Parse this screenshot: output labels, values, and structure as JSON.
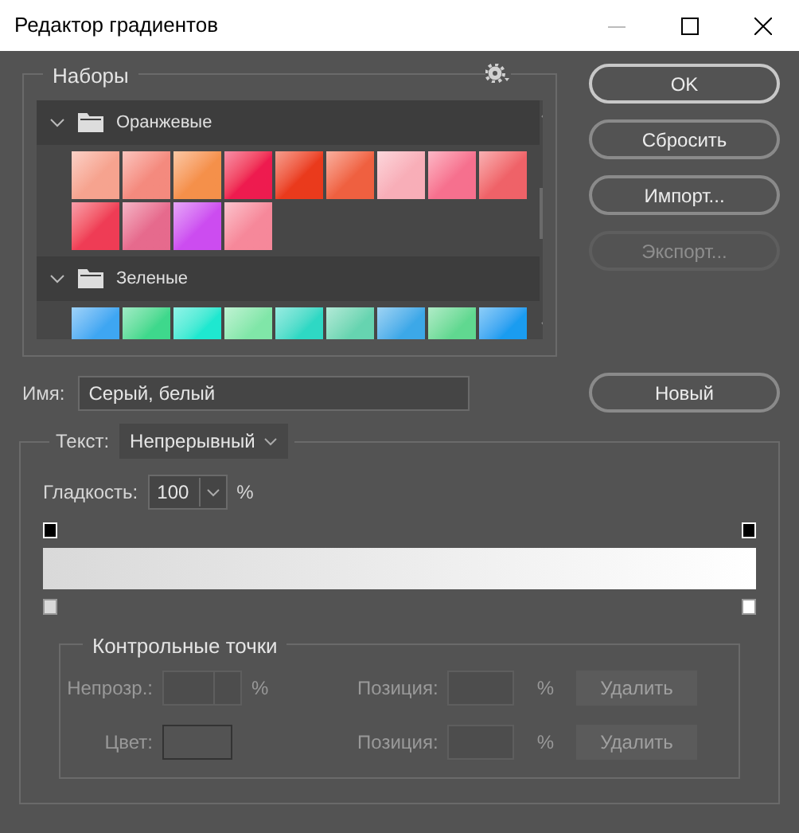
{
  "window": {
    "title": "Редактор градиентов"
  },
  "presets": {
    "title": "Наборы",
    "groups": [
      {
        "name": "Оранжевые",
        "expanded": true,
        "swatches": [
          {
            "color": "#f6a38f"
          },
          {
            "color": "#f48a7e"
          },
          {
            "color": "#f5904a"
          },
          {
            "color": "#ee1b4f"
          },
          {
            "color": "#ea3a1c"
          },
          {
            "color": "#ef6040"
          },
          {
            "color": "#f8aeb8"
          },
          {
            "color": "#f6708e"
          },
          {
            "color": "#ef6268"
          },
          {
            "color": "#ef3c55"
          },
          {
            "color": "#e66a8d"
          },
          {
            "color": "#cc4cf0"
          },
          {
            "color": "#f6889a"
          }
        ]
      },
      {
        "name": "Зеленые",
        "expanded": true,
        "swatches": [
          {
            "color": "#3ea6f2"
          },
          {
            "color": "#3ed88c"
          },
          {
            "color": "#1ee8d0"
          },
          {
            "color": "#80e6a8"
          },
          {
            "color": "#2ed8c4"
          },
          {
            "color": "#66d4b0"
          },
          {
            "color": "#3ca8e8"
          },
          {
            "color": "#60d890"
          },
          {
            "color": "#1a9cf0"
          }
        ]
      }
    ]
  },
  "buttons": [
    {
      "label": "OK",
      "disabled": false,
      "selected": true
    },
    {
      "label": "Сбросить",
      "disabled": false,
      "selected": false
    },
    {
      "label": "Импорт...",
      "disabled": false,
      "selected": false
    },
    {
      "label": "Экспорт...",
      "disabled": true,
      "selected": false
    }
  ],
  "name_field": {
    "label": "Имя:",
    "value": "Серый, белый"
  },
  "new_button": {
    "label": "Новый"
  },
  "gradient": {
    "type_label": "Текст:",
    "type_value": "Непрерывный",
    "smoothness_label": "Гладкость:",
    "smoothness_value": "100",
    "smoothness_unit": "%",
    "opacity_stops": [
      {
        "color": "#000000"
      },
      {
        "color": "#000000"
      }
    ],
    "color_stops": [
      {
        "color": "#d9d9d9"
      },
      {
        "color": "#ffffff"
      }
    ]
  },
  "control_points": {
    "title": "Контрольные точки",
    "rows": [
      {
        "kind": "opacity",
        "label": "Непрозр.:",
        "unit": "%",
        "position_label": "Позиция:",
        "position_unit": "%",
        "button": "Удалить",
        "disabled": true
      },
      {
        "kind": "color",
        "label": "Цвет:",
        "position_label": "Позиция:",
        "position_unit": "%",
        "button": "Удалить",
        "disabled": true
      }
    ]
  }
}
